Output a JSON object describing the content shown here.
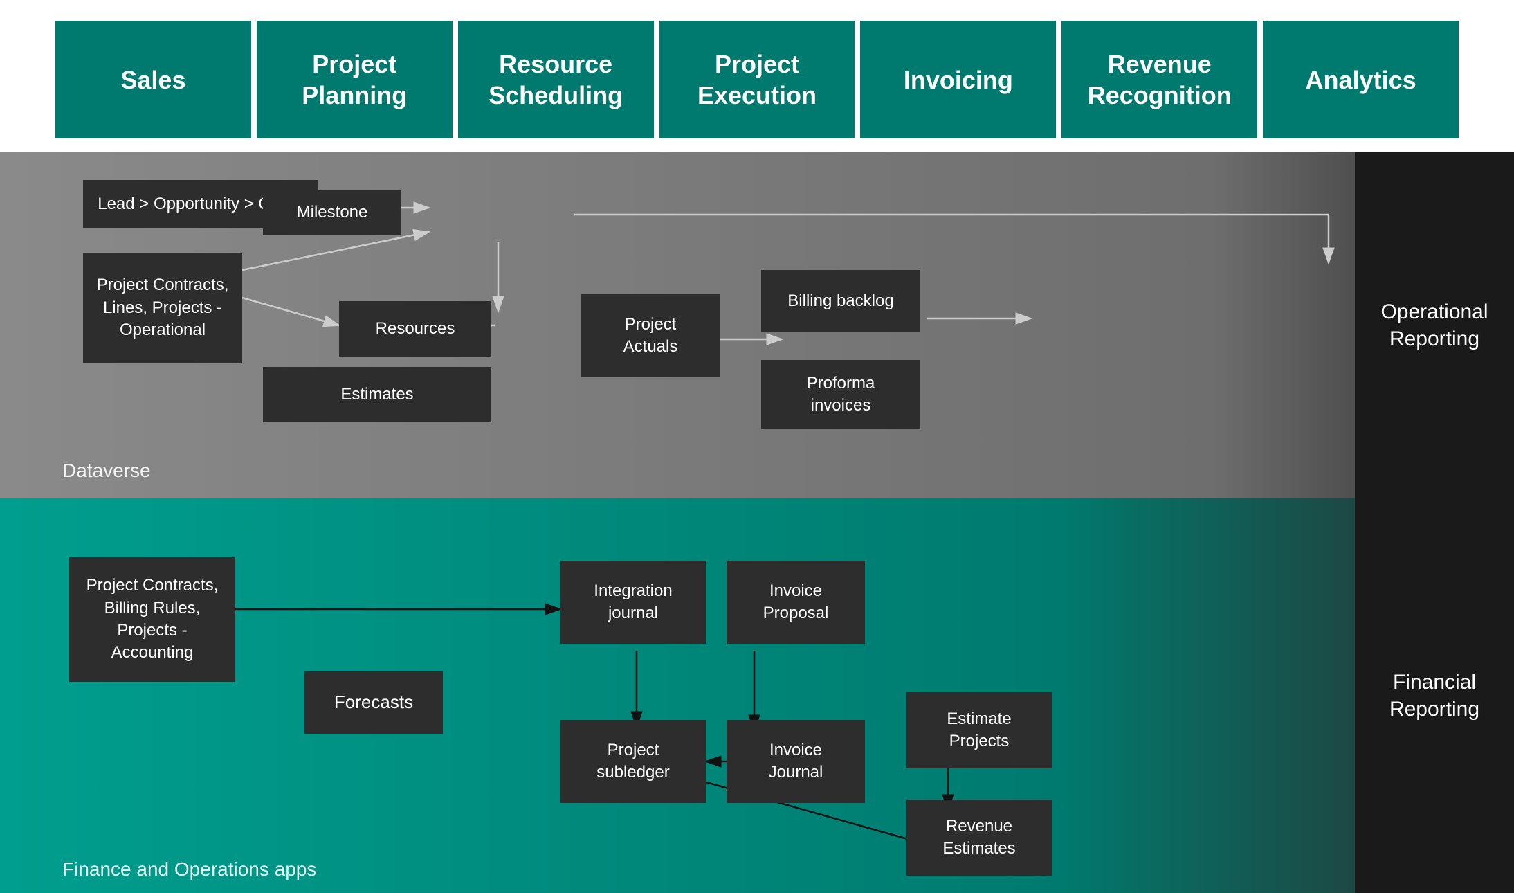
{
  "header": {
    "tiles": [
      {
        "label": "Sales"
      },
      {
        "label": "Project\nPlanning"
      },
      {
        "label": "Resource\nScheduling"
      },
      {
        "label": "Project\nExecution"
      },
      {
        "label": "Invoicing"
      },
      {
        "label": "Revenue\nRecognition"
      },
      {
        "label": "Analytics"
      }
    ]
  },
  "dataverse": {
    "section_label": "Dataverse",
    "right_label": "Operational\nReporting",
    "boxes": {
      "lead_quote": "Lead > Opportunity > Quote",
      "project_contracts_op": "Project Contracts,\nLines, Projects -\nOperational",
      "milestone": "Milestone",
      "resources": "Resources",
      "estimates": "Estimates",
      "project_actuals": "Project\nActuals",
      "billing_backlog": "Billing backlog",
      "proforma_invoices": "Proforma\ninvoices"
    }
  },
  "finance": {
    "section_label": "Finance and Operations apps",
    "right_label": "Financial\nReporting",
    "boxes": {
      "project_contracts_acc": "Project Contracts,\nBilling Rules,\nProjects -\nAccounting",
      "forecasts": "Forecasts",
      "integration_journal": "Integration\njournal",
      "invoice_proposal": "Invoice\nProposal",
      "project_subledger": "Project\nsubledger",
      "invoice_journal": "Invoice\nJournal",
      "estimate_projects": "Estimate\nProjects",
      "revenue_estimates": "Revenue\nEstimates"
    }
  }
}
